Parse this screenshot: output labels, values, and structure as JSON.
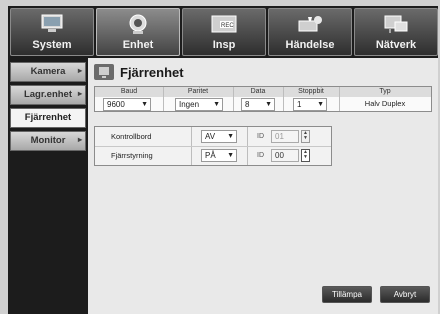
{
  "top_tabs": [
    {
      "label": "System",
      "icon": "monitor-icon"
    },
    {
      "label": "Enhet",
      "icon": "camera-icon"
    },
    {
      "label": "Insp",
      "icon": "rec-icon"
    },
    {
      "label": "Händelse",
      "icon": "alarm-icon"
    },
    {
      "label": "Nätverk",
      "icon": "network-icon"
    }
  ],
  "sidebar": {
    "items": [
      {
        "label": "Kamera"
      },
      {
        "label": "Lagr.enhet"
      },
      {
        "label": "Fjärrenhet"
      },
      {
        "label": "Monitor"
      }
    ]
  },
  "main": {
    "title": "Fjärrenhet",
    "serial_table": {
      "headers": [
        "Baud",
        "Paritet",
        "Data",
        "Stoppbit",
        "Typ"
      ],
      "values": {
        "baud": "9600",
        "paritet": "Ingen",
        "data": "8",
        "stoppbit": "1",
        "typ": "Halv Duplex"
      }
    },
    "devices": [
      {
        "label": "Kontrollbord",
        "value": "AV",
        "id_label": "ID",
        "id_value": "01"
      },
      {
        "label": "Fjärrstyrning",
        "value": "PÅ",
        "id_label": "ID",
        "id_value": "00"
      }
    ],
    "buttons": {
      "apply": "Tillämpa",
      "cancel": "Avbryt"
    }
  },
  "colors": {
    "tab_bg": "#2e2e2e",
    "panel_bg": "#e9e9e9",
    "frame_bg": "#1c1c1c"
  }
}
